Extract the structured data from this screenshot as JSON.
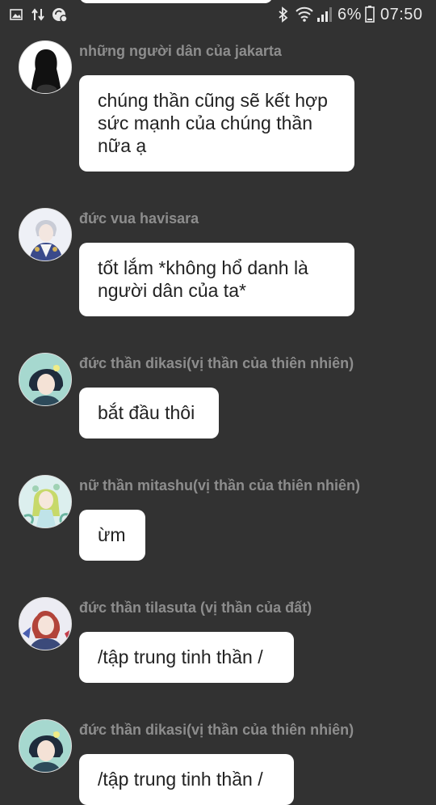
{
  "status_bar": {
    "battery": "6%",
    "time": "07:50",
    "icons": [
      "image-icon",
      "data-transfer-icon",
      "sync-icon",
      "bluetooth-icon",
      "wifi-icon",
      "signal-icon",
      "battery-icon"
    ]
  },
  "messages": [
    {
      "sender": "những người dân của jakarta",
      "text": "chúng thần cũng sẽ kết hợp sức mạnh của chúng thần nữa ạ",
      "avatar": "silhouette"
    },
    {
      "sender": "đức vua havisara",
      "text": "tốt lắm *không hổ danh là người dân của ta*",
      "avatar": "white-king"
    },
    {
      "sender": "đức thần dikasi(vị thần của thiên nhiên)",
      "text": "bắt đầu thôi",
      "avatar": "dikasi"
    },
    {
      "sender": "nữ thần mitashu(vị thần của thiên nhiên)",
      "text": "ừm",
      "avatar": "mitashu"
    },
    {
      "sender": "đức thần tilasuta (vị thần của đất)",
      "text": "/tập trung tinh thần /",
      "avatar": "tilasuta"
    },
    {
      "sender": "đức thần dikasi(vị thần của thiên nhiên)",
      "text": "/tập trung tinh thần /",
      "avatar": "dikasi"
    }
  ]
}
